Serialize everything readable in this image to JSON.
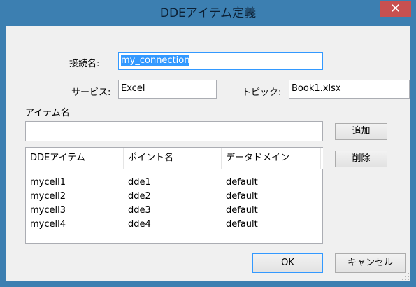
{
  "window": {
    "title": "DDEアイテム定義",
    "close_glyph": "✕"
  },
  "connection": {
    "label": "接続名:",
    "value": "my_connection"
  },
  "service": {
    "label": "サービス:",
    "value": "Excel"
  },
  "topic": {
    "label": "トピック:",
    "value": "Book1.xlsx"
  },
  "item_name": {
    "label": "アイテム名",
    "value": ""
  },
  "buttons": {
    "add": "追加",
    "delete": "削除",
    "ok": "OK",
    "cancel": "キャンセル"
  },
  "table": {
    "columns": [
      "DDEアイテム",
      "ポイント名",
      "データドメイン"
    ],
    "rows": [
      [
        "mycell1",
        "dde1",
        "default"
      ],
      [
        "mycell2",
        "dde2",
        "default"
      ],
      [
        "mycell3",
        "dde3",
        "default"
      ],
      [
        "mycell4",
        "dde4",
        "default"
      ]
    ]
  },
  "colors": {
    "title_bar": "#3c7fb1",
    "close_button": "#c75050",
    "selection": "#3399ff"
  }
}
